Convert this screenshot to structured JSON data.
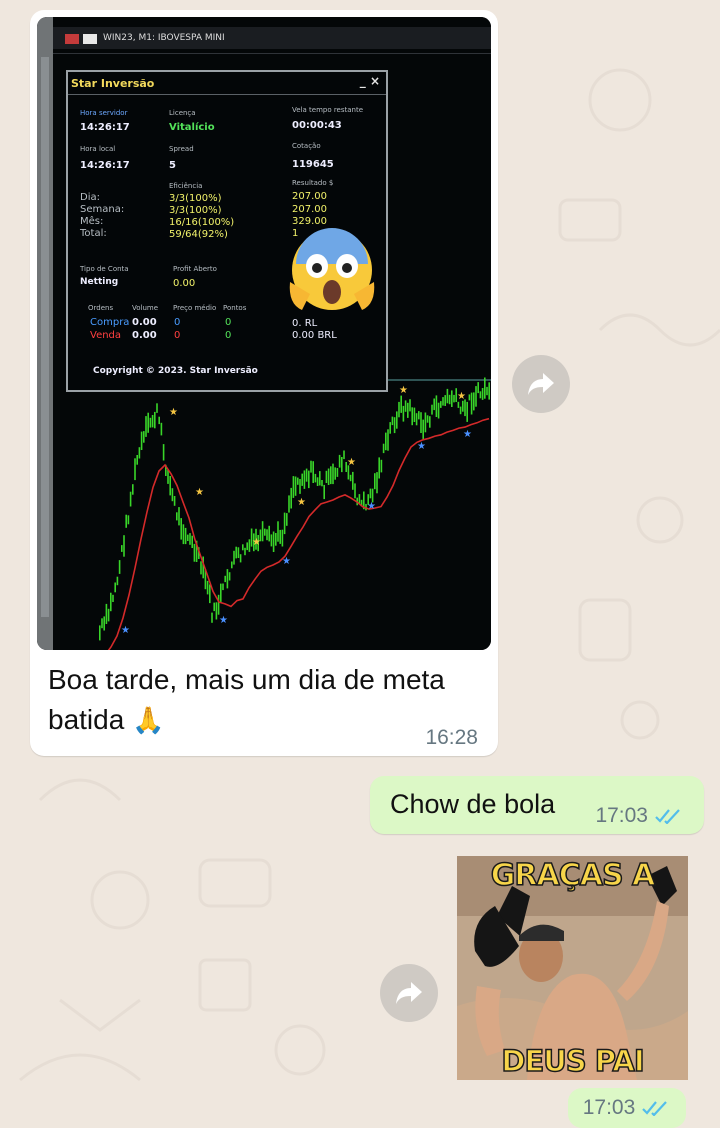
{
  "chat": {
    "incoming": {
      "caption_line1": "Boa tarde, mais um dia de meta",
      "caption_line2": "batida",
      "emoji": "🙏",
      "time": "16:28"
    },
    "outgoing_text": {
      "text": "Chow de bola",
      "time": "17:03",
      "status": "read"
    },
    "sticker": {
      "top_text": "GRAÇAS A",
      "bottom_text": "DEUS PAI",
      "time": "17:03",
      "status": "read"
    }
  },
  "terminal": {
    "window_title": "WIN23, M1: IBOVESPA MINI",
    "panel_title": "Star Inversão",
    "panel_controls": "_ ×",
    "labels": {
      "server_time": "Hora servidor",
      "license": "Licença",
      "candle_time_left": "Vela tempo restante",
      "local_time": "Hora local",
      "spread": "Spread",
      "quote": "Cotação",
      "efficiency": "Eficiência",
      "result": "Resultado $",
      "account_type": "Tipo de Conta",
      "open_profit": "Profit Aberto",
      "orders": "Ordens",
      "volume": "Volume",
      "avg_price": "Preço médio",
      "points": "Pontos"
    },
    "values": {
      "server_time": "14:26:17",
      "license": "Vitalício",
      "candle_time_left": "00:00:43",
      "local_time": "14:26:17",
      "spread": "5",
      "quote": "119645",
      "account_type": "Netting",
      "open_profit": "0.00"
    },
    "stats": [
      {
        "period": "Dia:",
        "efficiency": "3/3(100%)",
        "result": "207.00"
      },
      {
        "period": "Semana:",
        "efficiency": "3/3(100%)",
        "result": "207.00"
      },
      {
        "period": "Mês:",
        "efficiency": "16/16(100%)",
        "result": "329.00"
      },
      {
        "period": "Total:",
        "efficiency": "59/64(92%)",
        "result": "1"
      }
    ],
    "orders": [
      {
        "side": "Compra",
        "volume": "0.00",
        "avg": "0",
        "points": "0",
        "brl": "0. RL"
      },
      {
        "side": "Venda",
        "volume": "0.00",
        "avg": "0",
        "points": "0",
        "brl": "0.00 BRL"
      }
    ],
    "copyright": "Copyright © 2023. Star Inversão"
  },
  "colors": {
    "background": "#efe7de",
    "incoming_bubble": "#ffffff",
    "outgoing_bubble": "#dcf8c6",
    "read_ticks": "#53bdeb",
    "timestamp": "#667781",
    "chart_candles": "#39d529",
    "chart_average": "#d42a2a"
  },
  "icons": {
    "forward": "forward-arrow-icon",
    "read": "double-check-icon"
  }
}
